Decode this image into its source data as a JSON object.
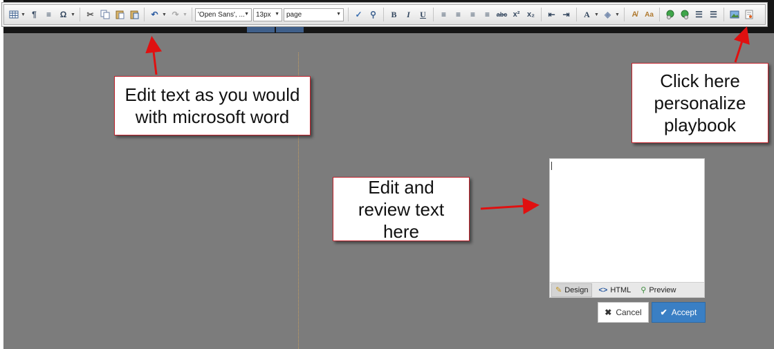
{
  "toolbar": {
    "font_family": "'Open Sans', ...",
    "font_size": "13px",
    "format_block": "page",
    "buttons": [
      {
        "name": "table-icon",
        "glyph": "▦"
      },
      {
        "name": "paragraph-icon",
        "glyph": "¶"
      },
      {
        "name": "horizontal-rule-icon",
        "glyph": "≡"
      },
      {
        "name": "special-char-icon",
        "glyph": "Ω"
      },
      {
        "name": "cut-icon",
        "glyph": "✂"
      },
      {
        "name": "copy-icon",
        "glyph": "⧉"
      },
      {
        "name": "paste-icon",
        "glyph": "📋"
      },
      {
        "name": "paste-word-icon",
        "glyph": "📋"
      },
      {
        "name": "undo-icon",
        "glyph": "↶"
      },
      {
        "name": "redo-icon",
        "glyph": "↷"
      },
      {
        "name": "spell-check-icon",
        "glyph": "✓"
      },
      {
        "name": "find-replace-icon",
        "glyph": "⚲"
      },
      {
        "name": "bold-icon",
        "glyph": "B"
      },
      {
        "name": "italic-icon",
        "glyph": "I"
      },
      {
        "name": "underline-icon",
        "glyph": "U"
      },
      {
        "name": "align-left-icon",
        "glyph": "≡"
      },
      {
        "name": "align-center-icon",
        "glyph": "≡"
      },
      {
        "name": "align-right-icon",
        "glyph": "≡"
      },
      {
        "name": "justify-icon",
        "glyph": "≡"
      },
      {
        "name": "strikethrough-icon",
        "glyph": "abc"
      },
      {
        "name": "superscript-icon",
        "glyph": "x²"
      },
      {
        "name": "subscript-icon",
        "glyph": "x₂"
      },
      {
        "name": "outdent-icon",
        "glyph": "⇤"
      },
      {
        "name": "indent-icon",
        "glyph": "⇥"
      },
      {
        "name": "font-color-icon",
        "glyph": "A"
      },
      {
        "name": "highlight-icon",
        "glyph": "◈"
      },
      {
        "name": "format-stripper-icon",
        "glyph": "A̸"
      },
      {
        "name": "convert-case-icon",
        "glyph": "Aa"
      },
      {
        "name": "link-icon",
        "glyph": "🔗"
      },
      {
        "name": "unlink-icon",
        "glyph": "⛓"
      },
      {
        "name": "ordered-list-icon",
        "glyph": "☰"
      },
      {
        "name": "bulleted-list-icon",
        "glyph": "☰"
      },
      {
        "name": "image-icon",
        "glyph": "▣"
      },
      {
        "name": "personalize-icon",
        "glyph": "▤"
      }
    ]
  },
  "callouts": {
    "word": "Edit text as you would with microsoft word",
    "personalize": "Click here personalize playbook",
    "review": "Edit and review text here"
  },
  "editor": {
    "tabs": {
      "design": "Design",
      "html": "HTML",
      "preview": "Preview"
    },
    "cancel_label": "Cancel",
    "accept_label": "Accept"
  },
  "colors": {
    "accent": "#3a7fc4",
    "callout_border": "#c0202a",
    "arrow": "#e01010",
    "background": "#7c7c7c"
  }
}
